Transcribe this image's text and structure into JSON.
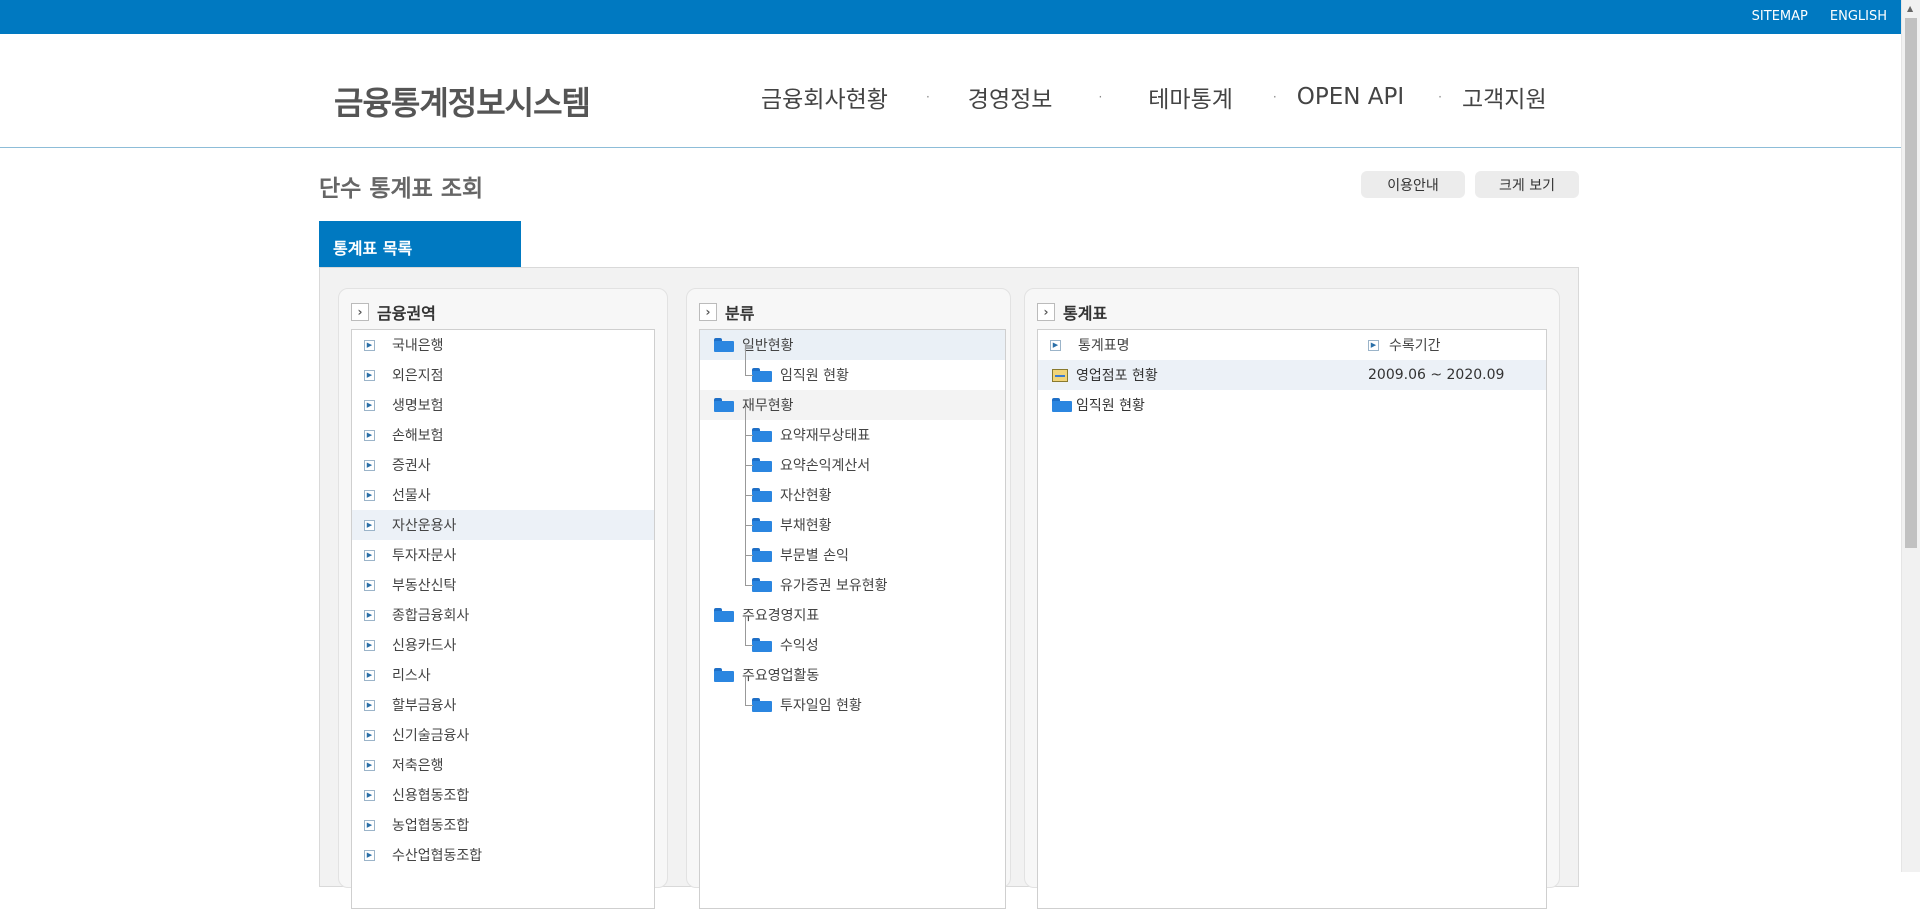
{
  "topbar": {
    "links": [
      "SITEMAP",
      "ENGLISH"
    ]
  },
  "header": {
    "logo": "금융통계정보시스템",
    "nav": [
      "금융회사현황",
      "경영정보",
      "테마통계",
      "OPEN API",
      "고객지원"
    ]
  },
  "page": {
    "title": "단수 통계표 조회",
    "buttons": {
      "guide": "이용안내",
      "large_view": "크게 보기"
    },
    "tab": "통계표 목록"
  },
  "panels": {
    "financial_sector": {
      "title": "금융권역",
      "items": [
        "국내은행",
        "외은지점",
        "생명보험",
        "손해보험",
        "증권사",
        "선물사",
        "자산운용사",
        "투자자문사",
        "부동산신탁",
        "종합금융회사",
        "신용카드사",
        "리스사",
        "할부금융사",
        "신기술금융사",
        "저축은행",
        "신용협동조합",
        "농업협동조합",
        "수산업협동조합"
      ],
      "selected": "자산운용사"
    },
    "category": {
      "title": "분류",
      "groups": [
        {
          "label": "일반현황",
          "children": [
            "임직원 현황"
          ]
        },
        {
          "label": "재무현황",
          "children": [
            "요약재무상태표",
            "요약손익계산서",
            "자산현황",
            "부채현황",
            "부문별 손익",
            "유가증권 보유현황"
          ]
        },
        {
          "label": "주요경영지표",
          "children": [
            "수익성"
          ]
        },
        {
          "label": "주요영업활동",
          "children": [
            "투자일임 현황"
          ]
        }
      ]
    },
    "stat_table": {
      "title": "통계표",
      "columns": {
        "name": "통계표명",
        "period": "수록기간"
      },
      "rows": [
        {
          "name": "영업점포 현황",
          "period": "2009.06 ~ 2020.09",
          "icon": "table-icon"
        },
        {
          "name": "임직원 현황",
          "period": "",
          "icon": "folder-icon"
        }
      ]
    }
  }
}
